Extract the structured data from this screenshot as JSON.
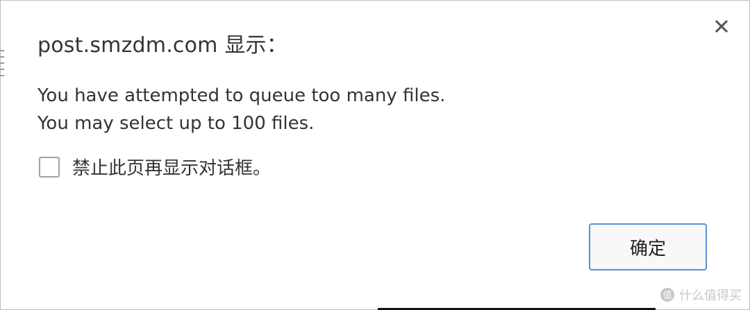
{
  "dialog": {
    "title": "post.smzdm.com 显示：",
    "close_icon": "close-icon",
    "message_lines": [
      "You have attempted to queue too many files.",
      "You may select up to 100 files."
    ],
    "checkbox_label": "禁止此页再显示对话框。",
    "checkbox_checked": false,
    "ok_label": "确定",
    "accent_color": "#5a8ed8"
  },
  "watermark": {
    "text": "什么值得买",
    "icon": "smzdm-logo-icon"
  }
}
